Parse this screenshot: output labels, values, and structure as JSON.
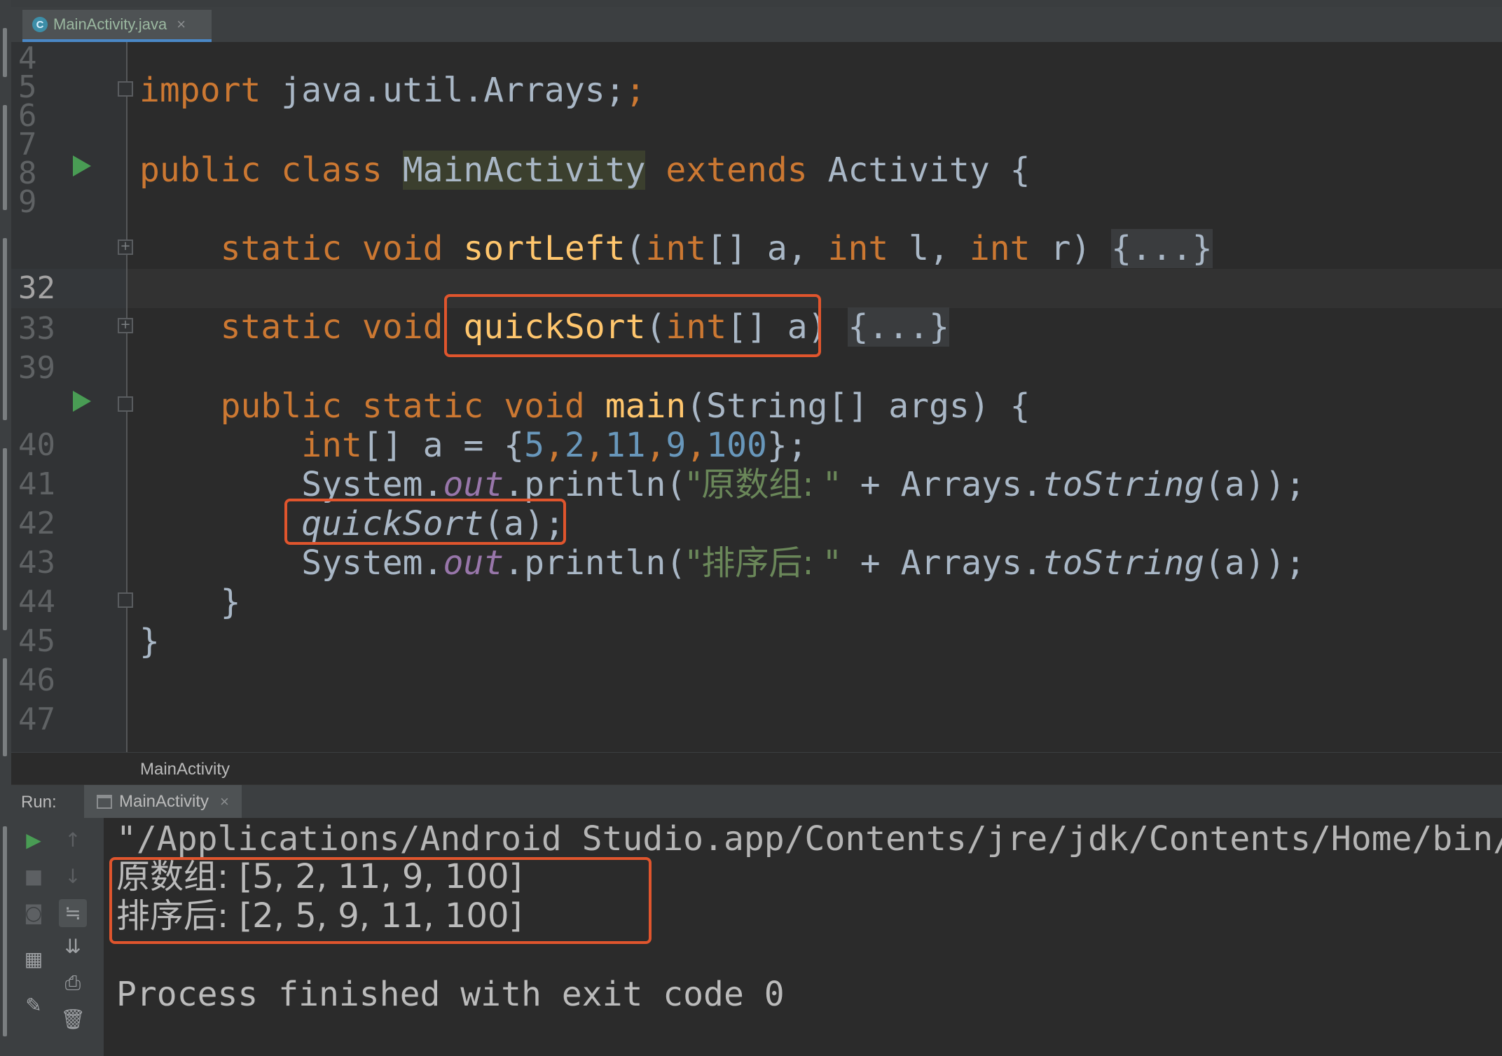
{
  "editor_tab": {
    "label": "MainActivity.java",
    "icon": "C"
  },
  "gutter": {
    "lines": [
      "4",
      "5",
      "6",
      "7",
      "8",
      "9",
      "32",
      "33",
      "39",
      "40",
      "41",
      "42",
      "43",
      "44",
      "45",
      "46",
      "47"
    ],
    "current": "32"
  },
  "code": {
    "l5": {
      "kw": "import",
      "rest": " java.util.Arrays;"
    },
    "l7": {
      "kw1": "public",
      "kw2": "class",
      "cls": "MainActivity",
      "kw3": "extends",
      "rest": " Activity {"
    },
    "l9": {
      "kw1": "static",
      "kw2": "void",
      "fn": "sortLeft",
      "p1": "(",
      "t1": "int",
      "p2": "[] a, ",
      "t2": "int",
      "p3": " l, ",
      "t3": "int",
      "p4": " r) ",
      "folded": "{...}"
    },
    "l33": {
      "kw1": "static",
      "kw2": "void",
      "fn": "quickSort",
      "p1": "(",
      "t1": "int",
      "p2": "[] a) ",
      "folded": "{...}"
    },
    "l40": {
      "kw1": "public",
      "kw2": "static",
      "kw3": "void",
      "fn": "main",
      "rest": "(String[] args) {"
    },
    "l41": {
      "kw": "int",
      "p1": "[] a = {",
      "n1": "5",
      "c1": ",",
      "n2": "2",
      "c2": ",",
      "n3": "11",
      "c3": ",",
      "n4": "9",
      "c4": ",",
      "n5": "100",
      "p2": "};"
    },
    "l42": {
      "a": "System.",
      "field": "out",
      "b": ".println(",
      "str": "\"原数组: \"",
      "c": " + Arrays.",
      "it": "toString",
      "d": "(a));"
    },
    "l43": {
      "it": "quickSort",
      "rest": "(a);"
    },
    "l44": {
      "a": "System.",
      "field": "out",
      "b": ".println(",
      "str": "\"排序后: \"",
      "c": " + Arrays.",
      "it": "toString",
      "d": "(a));"
    },
    "l45": "}",
    "l46": "}"
  },
  "breadcrumb": "MainActivity",
  "run_panel": {
    "label": "Run:",
    "tab": "MainActivity"
  },
  "console": {
    "cmd": "\"/Applications/Android Studio.app/Contents/jre/jdk/Contents/Home/bin/ja",
    "out1": "原数组: [5, 2, 11, 9, 100]",
    "out2": "排序后: [2, 5, 9, 11, 100]",
    "exit": "Process finished with exit code 0"
  },
  "colors": {
    "keyword": "#cc7832",
    "function": "#ffc66d",
    "number": "#6897bb",
    "string": "#6a8759",
    "field": "#9876aa",
    "highlight_box": "#e0552d",
    "run_green": "#499c54"
  },
  "icons": [
    "java-class-icon",
    "run-gutter-icon",
    "fold-icon",
    "console-icon",
    "rerun-icon",
    "stop-icon",
    "up-arrow-icon",
    "down-arrow-icon",
    "camera-icon",
    "soft-wrap-icon",
    "scroll-to-end-icon",
    "layout-icon",
    "print-icon",
    "pin-icon",
    "trash-icon"
  ]
}
